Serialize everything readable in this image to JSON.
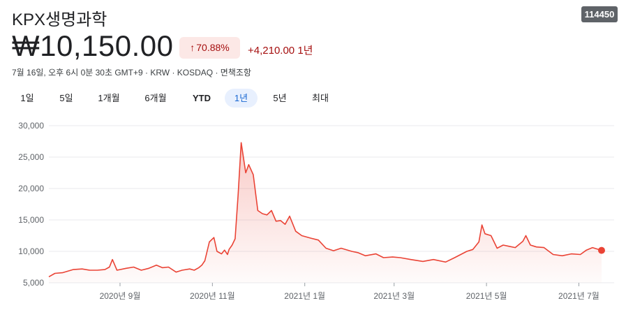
{
  "header": {
    "title": "KPX생명과학",
    "code": "114450",
    "price": "₩10,150.00",
    "change_pct": "70.88%",
    "change_abs": "+4,210.00 1년",
    "meta": "7월 16일, 오후 6시 0분 30초 GMT+9 · KRW · KOSDAQ · 면책조항"
  },
  "ranges": [
    "1일",
    "5일",
    "1개월",
    "6개월",
    "YTD",
    "1년",
    "5년",
    "최대"
  ],
  "active_range": "1년",
  "colors": {
    "line": "#ea4335",
    "up": "#a50e0e",
    "chip": "#fce8e6",
    "grid": "#e8eaed"
  },
  "chart_data": {
    "type": "area",
    "y_ticks": [
      "30,000",
      "25,000",
      "20,000",
      "15,000",
      "10,000",
      "5,000"
    ],
    "x_ticks": [
      "2020년 9월",
      "2020년 11월",
      "2021년 1월",
      "2021년 3월",
      "2021년 5월",
      "2021년 7월"
    ],
    "ylim": [
      5000,
      30000
    ],
    "x_label_dates": [
      "2020-09-01",
      "2020-11-01",
      "2021-01-01",
      "2021-03-01",
      "2021-05-01",
      "2021-07-01"
    ],
    "xlim": [
      "2020-07-16",
      "2021-07-16"
    ],
    "grid": true,
    "series": [
      {
        "x": [
          "2020-07-16",
          "2020-07-20",
          "2020-07-25",
          "2020-08-01",
          "2020-08-07",
          "2020-08-12",
          "2020-08-17",
          "2020-08-22",
          "2020-08-25",
          "2020-08-27",
          "2020-08-30",
          "2020-09-05",
          "2020-09-10",
          "2020-09-15",
          "2020-09-20",
          "2020-09-25",
          "2020-09-29",
          "2020-10-03",
          "2020-10-08",
          "2020-10-12",
          "2020-10-17",
          "2020-10-20",
          "2020-10-23",
          "2020-10-25",
          "2020-10-27",
          "2020-10-30",
          "2020-11-02",
          "2020-11-04",
          "2020-11-07",
          "2020-11-09",
          "2020-11-11",
          "2020-11-12",
          "2020-11-14",
          "2020-11-16",
          "2020-11-18",
          "2020-11-20",
          "2020-11-23",
          "2020-11-25",
          "2020-11-28",
          "2020-12-01",
          "2020-12-04",
          "2020-12-07",
          "2020-12-10",
          "2020-12-13",
          "2020-12-16",
          "2020-12-19",
          "2020-12-22",
          "2020-12-26",
          "2020-12-30",
          "2021-01-05",
          "2021-01-10",
          "2021-01-15",
          "2021-01-20",
          "2021-01-25",
          "2021-02-01",
          "2021-02-05",
          "2021-02-10",
          "2021-02-17",
          "2021-02-22",
          "2021-02-28",
          "2021-03-05",
          "2021-03-12",
          "2021-03-20",
          "2021-03-27",
          "2021-04-04",
          "2021-04-10",
          "2021-04-18",
          "2021-04-22",
          "2021-04-26",
          "2021-04-28",
          "2021-04-30",
          "2021-05-04",
          "2021-05-08",
          "2021-05-12",
          "2021-05-16",
          "2021-05-20",
          "2021-05-25",
          "2021-05-27",
          "2021-05-30",
          "2021-06-03",
          "2021-06-08",
          "2021-06-14",
          "2021-06-20",
          "2021-06-26",
          "2021-07-02",
          "2021-07-06",
          "2021-07-10",
          "2021-07-16"
        ],
        "values": [
          5950,
          6500,
          6600,
          7100,
          7200,
          7000,
          7000,
          7100,
          7500,
          8700,
          7000,
          7300,
          7500,
          7000,
          7300,
          7800,
          7400,
          7500,
          6700,
          7000,
          7200,
          7000,
          7400,
          7800,
          8500,
          11500,
          12200,
          10000,
          9600,
          10200,
          9500,
          10300,
          11000,
          12000,
          19000,
          27300,
          22500,
          23800,
          22200,
          16500,
          16000,
          15800,
          16500,
          14800,
          14900,
          14300,
          15600,
          13200,
          12500,
          12100,
          11800,
          10500,
          10100,
          10500,
          10000,
          9800,
          9300,
          9600,
          9000,
          9100,
          9000,
          8700,
          8400,
          8700,
          8300,
          9000,
          10000,
          10300,
          11500,
          14200,
          12800,
          12500,
          10500,
          11000,
          10800,
          10600,
          11600,
          12500,
          11000,
          10700,
          10600,
          9500,
          9300,
          9600,
          9500,
          10200,
          10600,
          10150
        ]
      }
    ]
  }
}
